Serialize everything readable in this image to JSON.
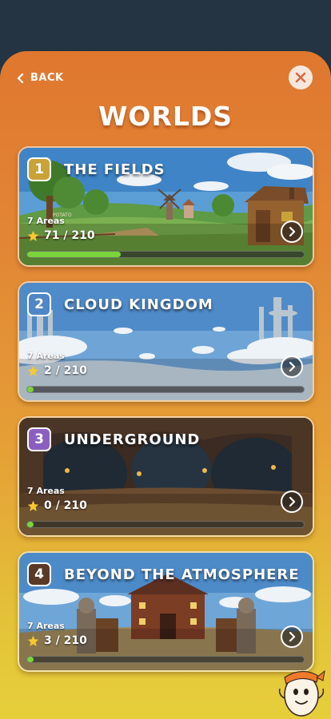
{
  "header": {
    "back_label": "BACK",
    "title": "WORLDS"
  },
  "worlds": [
    {
      "number": "1",
      "name": "THE FIELDS",
      "areas": "7 Areas",
      "stars": "71 / 210",
      "progress": 0.338,
      "badge_color": "#c9a23a"
    },
    {
      "number": "2",
      "name": "CLOUD KINGDOM",
      "areas": "7 Areas",
      "stars": "2 / 210",
      "progress": 0.01,
      "badge_color": "#4f87c6"
    },
    {
      "number": "3",
      "name": "UNDERGROUND",
      "areas": "7 Areas",
      "stars": "0 / 210",
      "progress": 0,
      "badge_color": "#8b5fc0"
    },
    {
      "number": "4",
      "name": "BEYOND THE ATMOSPHERE",
      "areas": "7 Areas",
      "stars": "3 / 210",
      "progress": 0.014,
      "badge_color": "#5a3a26"
    }
  ],
  "icons": {
    "back": "chevron-left-icon",
    "close": "close-icon",
    "star": "star-icon",
    "next": "chevron-right-icon"
  },
  "colors": {
    "progress_fill": "#7bd43b",
    "sheet_top": "#e0772f",
    "sheet_bottom": "#e6cf3b"
  },
  "decor": {
    "scene_sign_text": "POTATO"
  }
}
